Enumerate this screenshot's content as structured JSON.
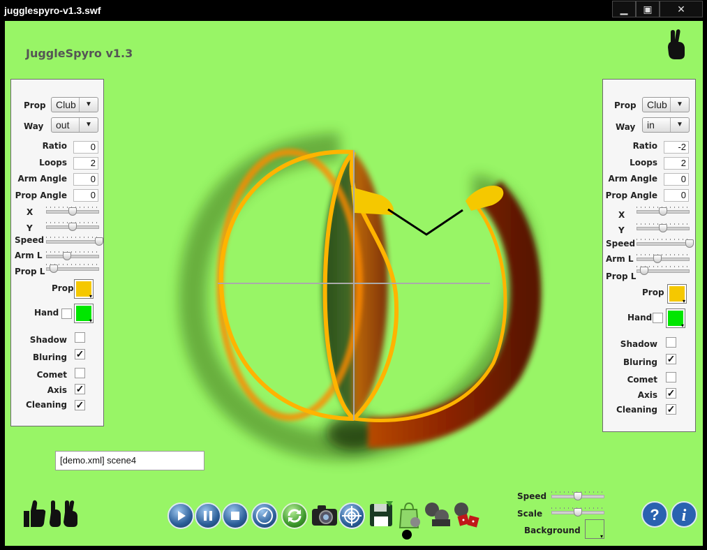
{
  "window": {
    "title": "jugglespyro-v1.3.swf",
    "minimize": "▁",
    "maximize": "▣",
    "close": "✕"
  },
  "app": {
    "title": "JuggleSpyro v1.3"
  },
  "left": {
    "prop_label": "Prop",
    "prop_value": "Club",
    "way_label": "Way",
    "way_value": "out",
    "ratio_label": "Ratio",
    "ratio": "0",
    "loops_label": "Loops",
    "loops": "2",
    "arm_angle_label": "Arm Angle",
    "arm_angle": "0",
    "prop_angle_label": "Prop Angle",
    "prop_angle": "0",
    "x_label": "X",
    "y_label": "Y",
    "speed_label": "Speed",
    "arm_l_label": "Arm L",
    "prop_l_label": "Prop L",
    "x_pos": 0.5,
    "y_pos": 0.5,
    "speed_pos": 1.0,
    "arm_l_pos": 0.4,
    "prop_l_pos": 0.15,
    "prop_color_label": "Prop",
    "prop_color": "#f5c800",
    "hand_label": "Hand",
    "hand_color": "#00e600",
    "shadow_label": "Shadow",
    "shadow": "",
    "bluring_label": "Bluring",
    "bluring": "✓",
    "comet_label": "Comet",
    "comet": "",
    "axis_label": "Axis",
    "axis": "✓",
    "cleaning_label": "Cleaning",
    "cleaning": "✓"
  },
  "right": {
    "prop_label": "Prop",
    "prop_value": "Club",
    "way_label": "Way",
    "way_value": "in",
    "ratio_label": "Ratio",
    "ratio": "-2",
    "loops_label": "Loops",
    "loops": "2",
    "arm_angle_label": "Arm Angle",
    "arm_angle": "0",
    "prop_angle_label": "Prop Angle",
    "prop_angle": "0",
    "x_label": "X",
    "y_label": "Y",
    "speed_label": "Speed",
    "arm_l_label": "Arm L",
    "prop_l_label": "Prop L",
    "x_pos": 0.5,
    "y_pos": 0.5,
    "speed_pos": 1.0,
    "arm_l_pos": 0.4,
    "prop_l_pos": 0.15,
    "prop_color_label": "Prop",
    "prop_color": "#f5c800",
    "hand_label": "Hand",
    "hand_color": "#00e600",
    "shadow_label": "Shadow",
    "shadow": "",
    "bluring_label": "Bluring",
    "bluring": "✓",
    "comet_label": "Comet",
    "comet": "",
    "axis_label": "Axis",
    "axis": "✓",
    "cleaning_label": "Cleaning",
    "cleaning": "✓"
  },
  "scene": {
    "value": "[demo.xml]  scene4"
  },
  "bottom": {
    "speed_label": "Speed",
    "speed_pos": 0.5,
    "scale_label": "Scale",
    "scale_pos": 0.5,
    "background_label": "Background"
  },
  "toolbar": {
    "icons": [
      "play-icon",
      "pause-icon",
      "stop-icon",
      "compass-icon",
      "refresh-icon",
      "camera-icon",
      "target-icon",
      "save-icon",
      "bag-icon",
      "film-icon",
      "dice-icon"
    ]
  },
  "colors": {
    "stage": "#98f566",
    "prop": "#f5c800",
    "hand": "#00e600"
  }
}
